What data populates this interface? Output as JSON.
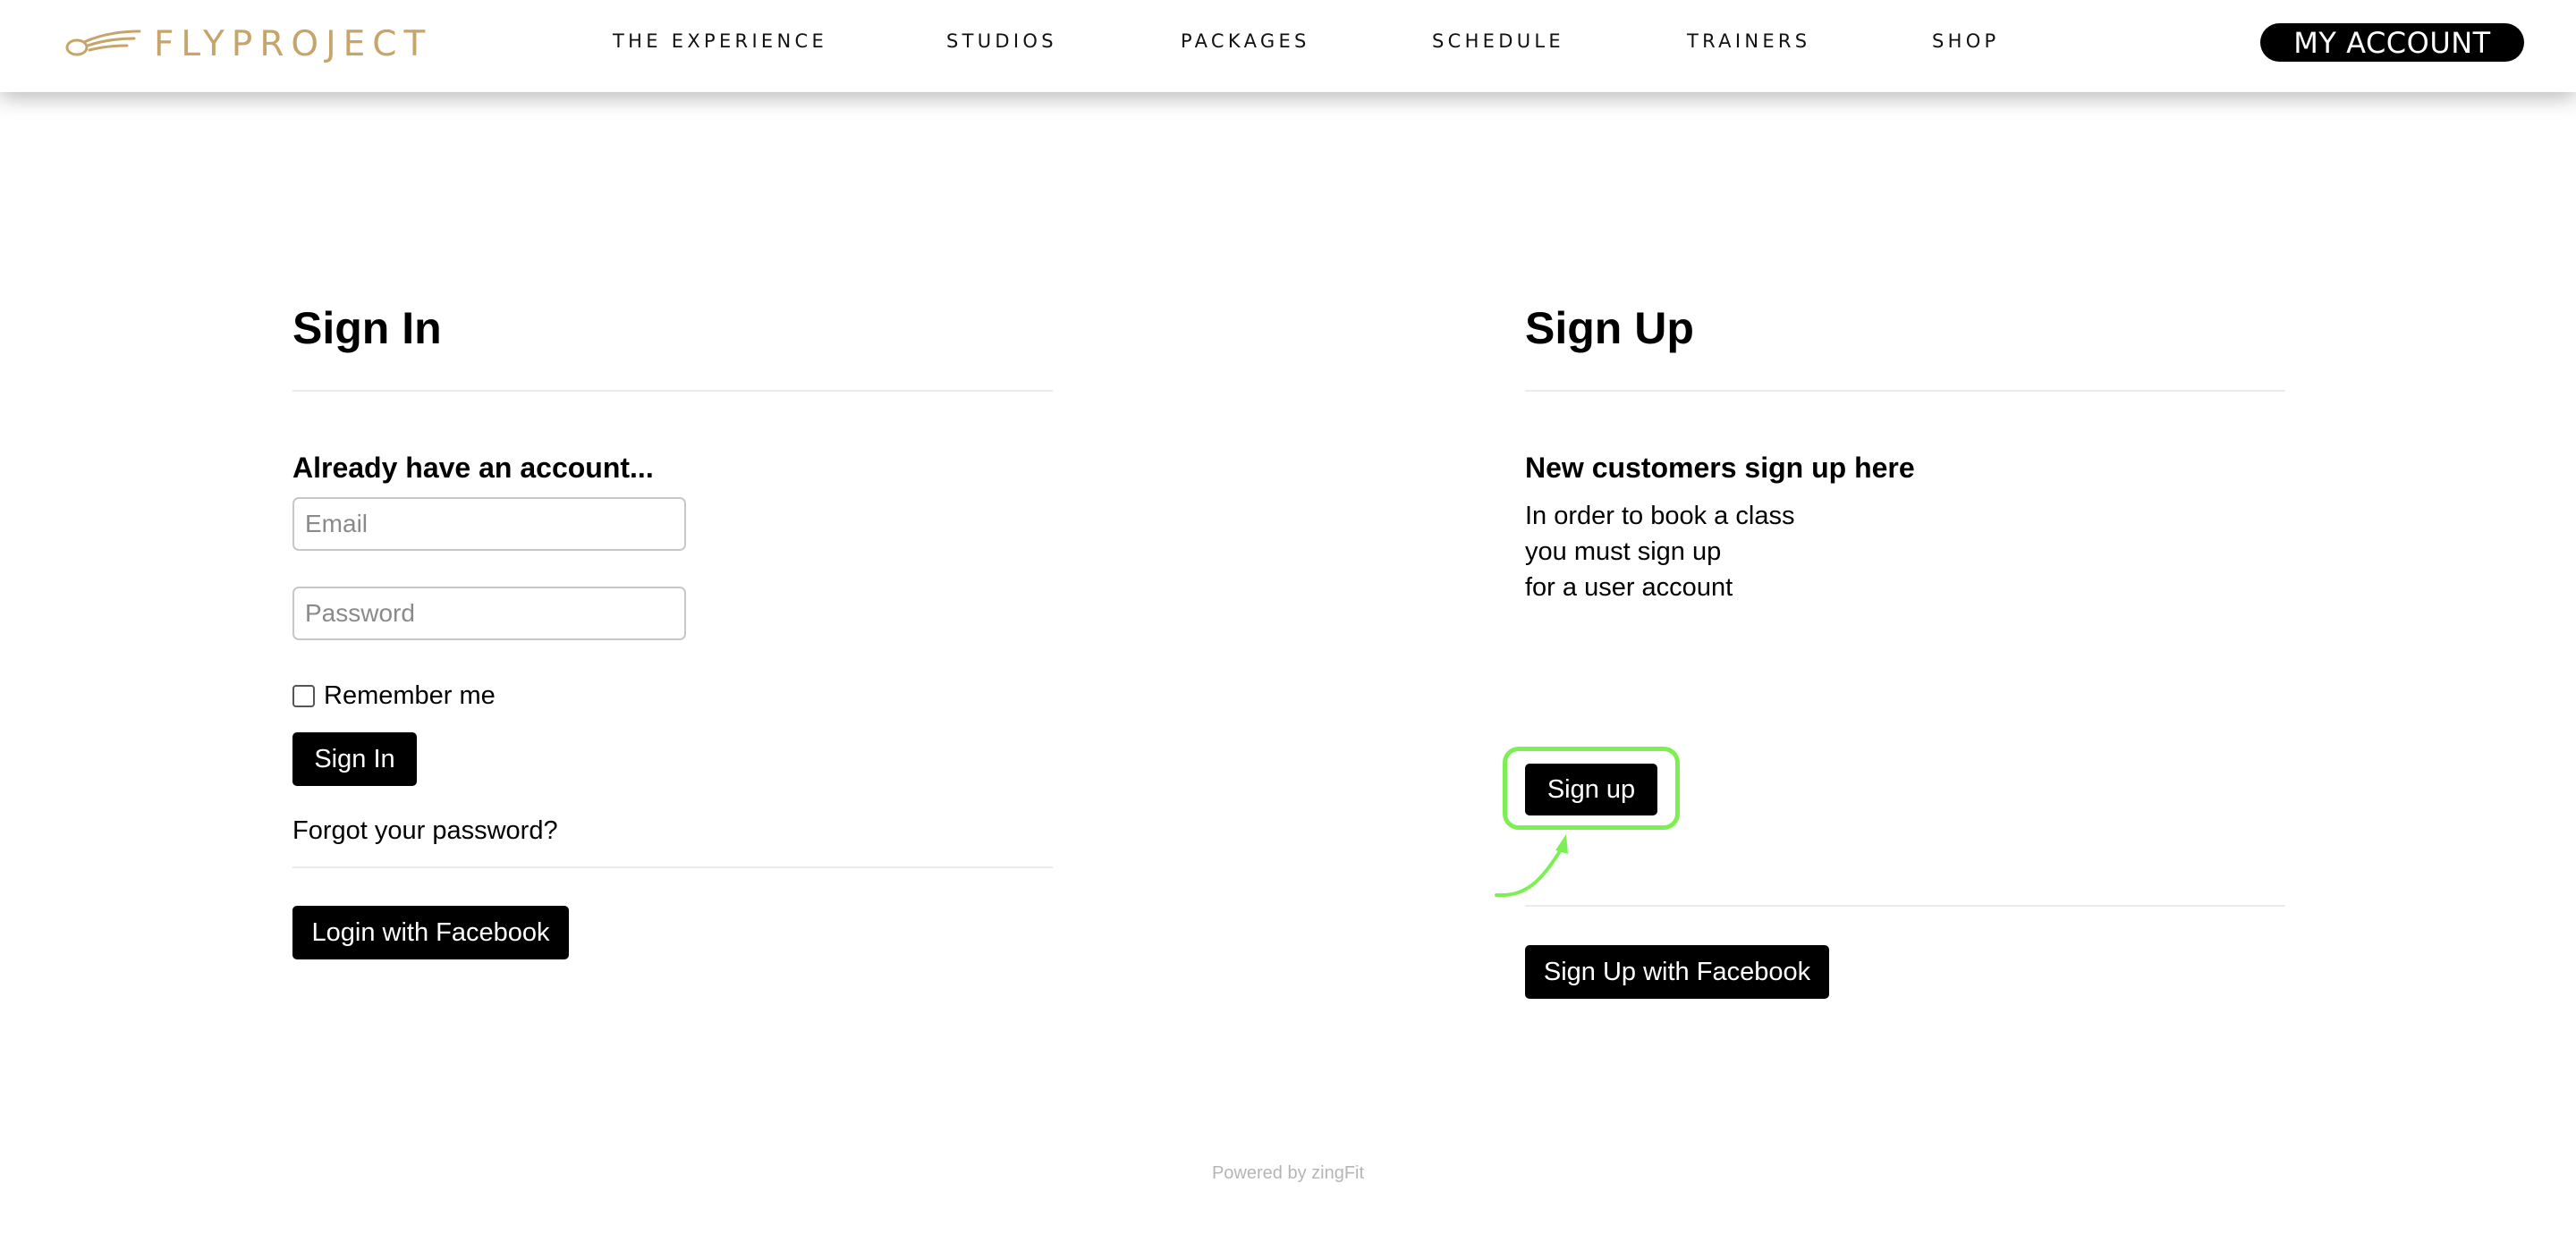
{
  "header": {
    "logo_text": "FLYPROJECT",
    "nav": [
      {
        "label": "THE EXPERIENCE"
      },
      {
        "label": "STUDIOS"
      },
      {
        "label": "PACKAGES"
      },
      {
        "label": "SCHEDULE"
      },
      {
        "label": "TRAINERS"
      },
      {
        "label": "SHOP"
      }
    ],
    "account_label": "MY ACCOUNT"
  },
  "signin": {
    "title": "Sign In",
    "subtitle": "Already have an account...",
    "email_placeholder": "Email",
    "password_placeholder": "Password",
    "remember_label": "Remember me",
    "button_label": "Sign In",
    "forgot_label": "Forgot your password?",
    "facebook_label": "Login with Facebook"
  },
  "signup": {
    "title": "Sign Up",
    "subtitle": "New customers sign up here",
    "description_lines": [
      "In order to book a class",
      "you must sign up",
      "for a user account"
    ],
    "button_label": "Sign up",
    "facebook_label": "Sign Up with Facebook"
  },
  "footer": {
    "powered_by": "Powered by zingFit"
  },
  "colors": {
    "brand_gold": "#c6a46a",
    "highlight_green": "#7cf052",
    "button_black": "#000000"
  },
  "icons": {
    "logo": "wing-logo-icon",
    "annotation": "curved-arrow-icon"
  }
}
